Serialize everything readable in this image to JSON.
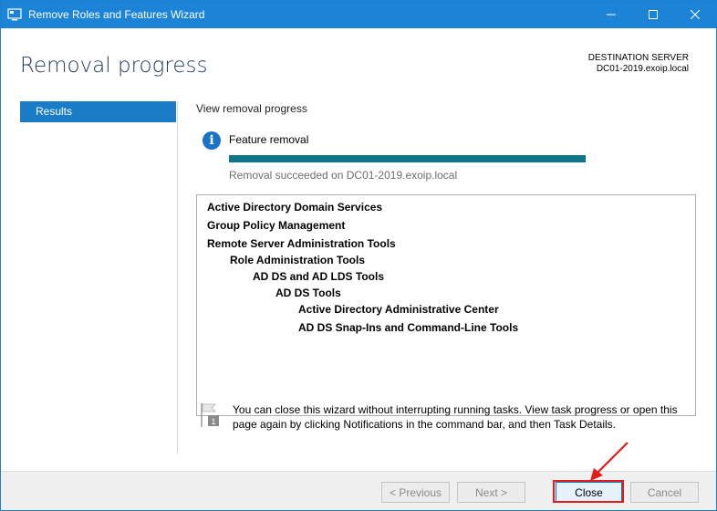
{
  "window": {
    "title": "Remove Roles and Features Wizard"
  },
  "header": {
    "page_title": "Removal progress",
    "destination_label": "DESTINATION SERVER",
    "destination_server": "DC01-2019.exoip.local"
  },
  "sidebar": {
    "items": [
      {
        "label": "Results",
        "selected": true
      }
    ]
  },
  "main": {
    "section_heading": "View removal progress",
    "feature_label": "Feature removal",
    "progress_percent": 100,
    "status_text": "Removal succeeded on DC01-2019.exoip.local",
    "results": [
      {
        "label": "Active Directory Domain Services",
        "level": 0
      },
      {
        "label": "Group Policy Management",
        "level": 0
      },
      {
        "label": "Remote Server Administration Tools",
        "level": 0
      },
      {
        "label": "Role Administration Tools",
        "level": 1
      },
      {
        "label": "AD DS and AD LDS Tools",
        "level": 2
      },
      {
        "label": "AD DS Tools",
        "level": 3
      },
      {
        "label": "Active Directory Administrative Center",
        "level": 4
      },
      {
        "label": "AD DS Snap-Ins and Command-Line Tools",
        "level": 4
      }
    ],
    "note_badge": "1",
    "note_text": "You can close this wizard without interrupting running tasks. View task progress or open this page again by clicking Notifications in the command bar, and then Task Details."
  },
  "footer": {
    "previous_label": "< Previous",
    "next_label": "Next >",
    "close_label": "Close",
    "cancel_label": "Cancel"
  },
  "colors": {
    "titlebar": "#1c84d6",
    "accent": "#1a7bc6",
    "progress": "#0f7589",
    "highlight": "#e21b1b"
  }
}
